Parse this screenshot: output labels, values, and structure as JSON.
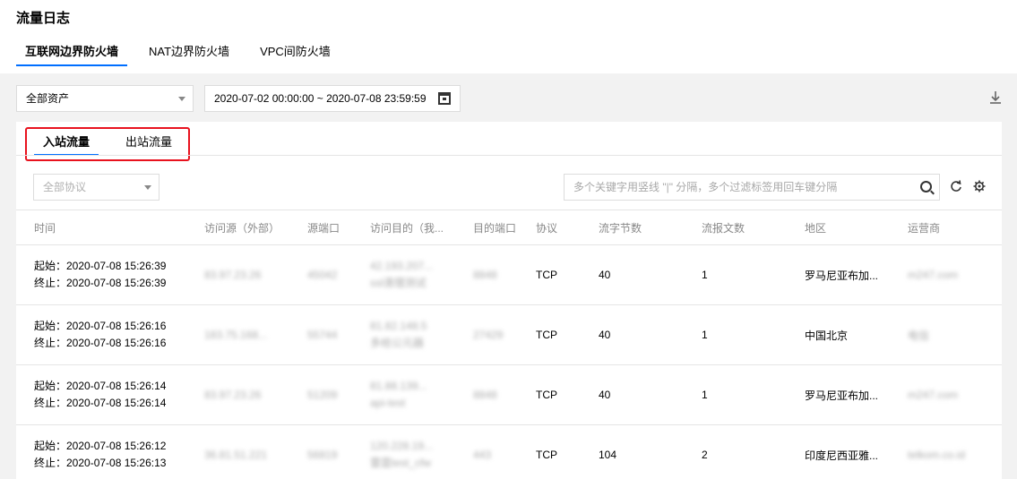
{
  "page": {
    "title": "流量日志"
  },
  "firewall_tabs": [
    {
      "label": "互联网边界防火墙",
      "active": true
    },
    {
      "label": "NAT边界防火墙",
      "active": false
    },
    {
      "label": "VPC间防火墙",
      "active": false
    }
  ],
  "filters": {
    "asset": "全部资产",
    "date_range": "2020-07-02 00:00:00 ~ 2020-07-08 23:59:59"
  },
  "traffic_tabs": [
    {
      "label": "入站流量",
      "active": true
    },
    {
      "label": "出站流量",
      "active": false
    }
  ],
  "table_filters": {
    "protocol_placeholder": "全部协议",
    "search_placeholder": "多个关键字用竖线 \"|\" 分隔，多个过滤标签用回车键分隔"
  },
  "columns": [
    "时间",
    "访问源（外部）",
    "源端口",
    "访问目的（我...",
    "目的端口",
    "协议",
    "流字节数",
    "流报文数",
    "地区",
    "运营商"
  ],
  "rows": [
    {
      "start": "起始：2020-07-08 15:26:39",
      "end": "终止：2020-07-08 15:26:39",
      "src": "83.97.23.26",
      "src_port": "45042",
      "dst1": "42.193.207...",
      "dst2": "ssl清理测试",
      "dst_port": "8848",
      "protocol": "TCP",
      "bytes": "40",
      "packets": "1",
      "region": "罗马尼亚布加...",
      "isp": "m247.com"
    },
    {
      "start": "起始：2020-07-08 15:26:16",
      "end": "终止：2020-07-08 15:26:16",
      "src": "183.75.168...",
      "src_port": "55744",
      "dst1": "81.82.148.5",
      "dst2": "多给公元器",
      "dst_port": "27429",
      "protocol": "TCP",
      "bytes": "40",
      "packets": "1",
      "region": "中国北京",
      "isp": "电信"
    },
    {
      "start": "起始：2020-07-08 15:26:14",
      "end": "终止：2020-07-08 15:26:14",
      "src": "83.97.23.26",
      "src_port": "51209",
      "dst1": "81.88.139...",
      "dst2": "api-test",
      "dst_port": "8848",
      "protocol": "TCP",
      "bytes": "40",
      "packets": "1",
      "region": "罗马尼亚布加...",
      "isp": "m247.com"
    },
    {
      "start": "起始：2020-07-08 15:26:12",
      "end": "终止：2020-07-08 15:26:13",
      "src": "36.81.51.221",
      "src_port": "56819",
      "dst1": "120.228.19...",
      "dst2": "雷霆test_cfw",
      "dst_port": "443",
      "protocol": "TCP",
      "bytes": "104",
      "packets": "2",
      "region": "印度尼西亚雅...",
      "isp": "telkom.co.id"
    }
  ],
  "icons": {
    "download": "download-icon",
    "calendar": "calendar-icon",
    "search": "search-icon",
    "refresh": "refresh-icon",
    "settings": "settings-icon"
  },
  "colors": {
    "accent": "#006eff",
    "highlight_box": "#e8121e"
  }
}
